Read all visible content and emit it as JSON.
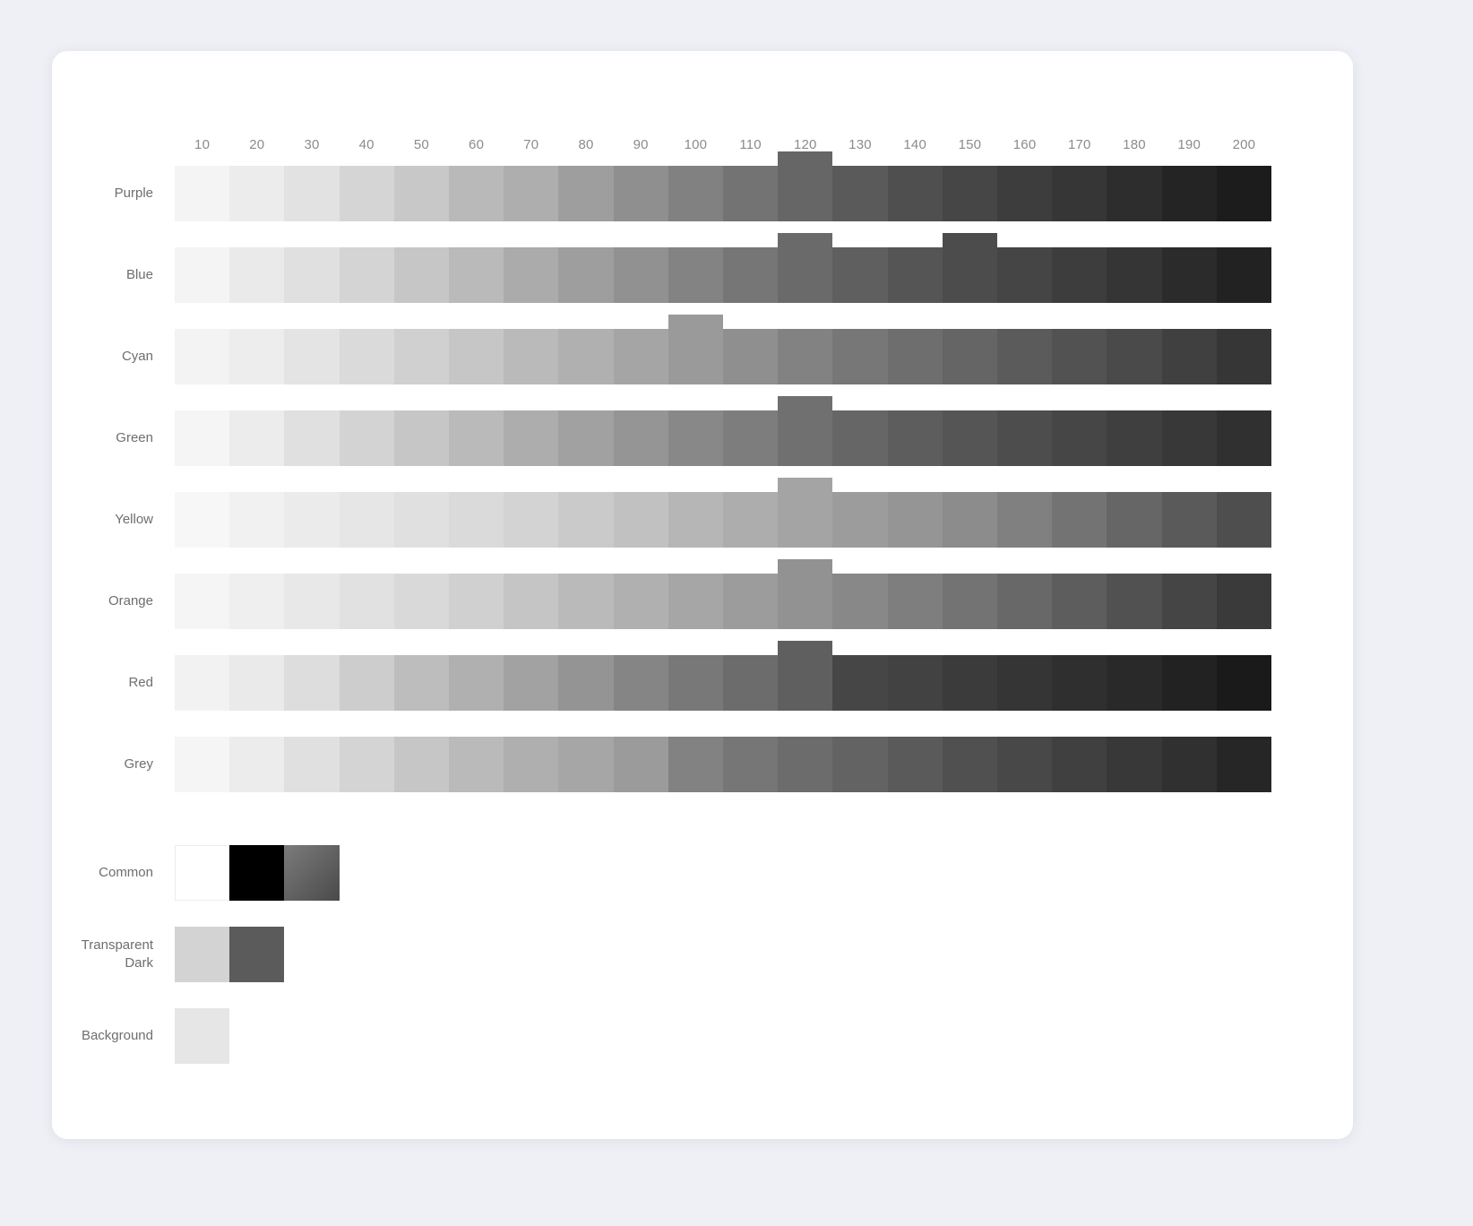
{
  "card": {
    "background": "#ffffff",
    "page_background": "#eef0f5"
  },
  "columns": {
    "labels": [
      "10",
      "20",
      "30",
      "40",
      "50",
      "60",
      "70",
      "80",
      "90",
      "100",
      "110",
      "120",
      "130",
      "140",
      "150",
      "160",
      "170",
      "180",
      "190",
      "200"
    ],
    "label_color": "#8b8b8b"
  },
  "rows": [
    {
      "label": "Purple",
      "highlighted": [
        "120"
      ],
      "swatches": [
        "#f4f4f4",
        "#ececec",
        "#e2e2e2",
        "#d5d5d5",
        "#c8c8c8",
        "#b9b9b9",
        "#aeaeae",
        "#9e9e9e",
        "#8f8f8f",
        "#818181",
        "#737373",
        "#666666",
        "#5a5a5a",
        "#4f4f4f",
        "#464646",
        "#3d3d3d",
        "#363636",
        "#2d2d2d",
        "#242424",
        "#1c1c1c"
      ]
    },
    {
      "label": "Blue",
      "highlighted": [
        "120",
        "150"
      ],
      "swatches": [
        "#f4f4f4",
        "#eaeaea",
        "#e0e0e0",
        "#d4d4d4",
        "#c6c6c6",
        "#bababa",
        "#ababab",
        "#9e9e9e",
        "#919191",
        "#838383",
        "#767676",
        "#6a6a6a",
        "#5f5f5f",
        "#555555",
        "#4c4c4c",
        "#454545",
        "#3d3d3d",
        "#353535",
        "#2b2b2b",
        "#222222"
      ]
    },
    {
      "label": "Cyan",
      "highlighted": [
        "100"
      ],
      "swatches": [
        "#f3f3f3",
        "#ededed",
        "#e4e4e4",
        "#dadada",
        "#d0d0d0",
        "#c6c6c6",
        "#bababa",
        "#b0b0b0",
        "#a5a5a5",
        "#9a9a9a",
        "#8f8f8f",
        "#828282",
        "#777777",
        "#6e6e6e",
        "#656565",
        "#5b5b5b",
        "#525252",
        "#4a4a4a",
        "#404040",
        "#363636"
      ]
    },
    {
      "label": "Green",
      "highlighted": [
        "120"
      ],
      "swatches": [
        "#f5f5f5",
        "#ececec",
        "#e0e0e0",
        "#d3d3d3",
        "#c6c6c6",
        "#bababa",
        "#adadad",
        "#a1a1a1",
        "#959595",
        "#888888",
        "#7d7d7d",
        "#707070",
        "#666666",
        "#5d5d5d",
        "#555555",
        "#4d4d4d",
        "#464646",
        "#3f3f3f",
        "#383838",
        "#303030"
      ]
    },
    {
      "label": "Yellow",
      "highlighted": [
        "120"
      ],
      "swatches": [
        "#f7f7f7",
        "#f1f1f1",
        "#ebebeb",
        "#e6e6e6",
        "#e0e0e0",
        "#dadada",
        "#d3d3d3",
        "#cacaca",
        "#c1c1c1",
        "#b6b6b6",
        "#adadad",
        "#a4a4a4",
        "#9c9c9c",
        "#959595",
        "#8c8c8c",
        "#808080",
        "#737373",
        "#666666",
        "#5a5a5a",
        "#4e4e4e"
      ]
    },
    {
      "label": "Orange",
      "highlighted": [
        "120"
      ],
      "swatches": [
        "#f5f5f5",
        "#efefef",
        "#e8e8e8",
        "#e1e1e1",
        "#d9d9d9",
        "#d0d0d0",
        "#c5c5c5",
        "#bababa",
        "#b0b0b0",
        "#a6a6a6",
        "#9c9c9c",
        "#929292",
        "#888888",
        "#7e7e7e",
        "#737373",
        "#686868",
        "#5d5d5d",
        "#515151",
        "#454545",
        "#3a3a3a"
      ]
    },
    {
      "label": "Red",
      "highlighted": [
        "120"
      ],
      "swatches": [
        "#f2f2f2",
        "#eaeaea",
        "#dddddd",
        "#cdcdcd",
        "#bdbdbd",
        "#b0b0b0",
        "#a2a2a2",
        "#949494",
        "#858585",
        "#787878",
        "#6c6c6c",
        "#5f5f5f",
        "#464646",
        "#424242",
        "#3b3b3b",
        "#353535",
        "#2f2f2f",
        "#292929",
        "#222222",
        "#1a1a1a"
      ]
    },
    {
      "label": "Grey",
      "highlighted": [],
      "swatches": [
        "#f5f5f5",
        "#ececec",
        "#e0e0e0",
        "#d4d4d4",
        "#c6c6c6",
        "#bababa",
        "#afafaf",
        "#a6a6a6",
        "#9b9b9b",
        "#828282",
        "#767676",
        "#6c6c6c",
        "#636363",
        "#5a5a5a",
        "#505050",
        "#484848",
        "#404040",
        "#383838",
        "#303030",
        "#262626"
      ]
    }
  ],
  "special_rows": [
    {
      "label": "Common",
      "swatches": [
        {
          "name": "white",
          "color": "#ffffff",
          "bordered": true
        },
        {
          "name": "black",
          "color": "#000000",
          "bordered": false
        },
        {
          "name": "gradient",
          "color": "#7b7b7b",
          "gradient_to": "#4a4a4a",
          "bordered": false
        }
      ]
    },
    {
      "label": "Transparent\nDark",
      "swatches": [
        {
          "name": "transparent-light",
          "color": "#d3d3d3",
          "bordered": false
        },
        {
          "name": "transparent-dark",
          "color": "#5b5b5b",
          "bordered": false
        }
      ]
    },
    {
      "label": "Background",
      "swatches": [
        {
          "name": "background",
          "color": "#e6e6e6",
          "bordered": false
        }
      ]
    }
  ],
  "chart_data": {
    "type": "heatmap",
    "title": "",
    "xlabel": "",
    "ylabel": "",
    "categories": [
      "10",
      "20",
      "30",
      "40",
      "50",
      "60",
      "70",
      "80",
      "90",
      "100",
      "110",
      "120",
      "130",
      "140",
      "150",
      "160",
      "170",
      "180",
      "190",
      "200"
    ],
    "series": [
      {
        "name": "Purple",
        "values": [
          "#f4f4f4",
          "#ececec",
          "#e2e2e2",
          "#d5d5d5",
          "#c8c8c8",
          "#b9b9b9",
          "#aeaeae",
          "#9e9e9e",
          "#8f8f8f",
          "#818181",
          "#737373",
          "#666666",
          "#5a5a5a",
          "#4f4f4f",
          "#464646",
          "#3d3d3d",
          "#363636",
          "#2d2d2d",
          "#242424",
          "#1c1c1c"
        ]
      },
      {
        "name": "Blue",
        "values": [
          "#f4f4f4",
          "#eaeaea",
          "#e0e0e0",
          "#d4d4d4",
          "#c6c6c6",
          "#bababa",
          "#ababab",
          "#9e9e9e",
          "#919191",
          "#838383",
          "#767676",
          "#6a6a6a",
          "#5f5f5f",
          "#555555",
          "#4c4c4c",
          "#454545",
          "#3d3d3d",
          "#353535",
          "#2b2b2b",
          "#222222"
        ]
      },
      {
        "name": "Cyan",
        "values": [
          "#f3f3f3",
          "#ededed",
          "#e4e4e4",
          "#dadada",
          "#d0d0d0",
          "#c6c6c6",
          "#bababa",
          "#b0b0b0",
          "#a5a5a5",
          "#9a9a9a",
          "#8f8f8f",
          "#828282",
          "#777777",
          "#6e6e6e",
          "#656565",
          "#5b5b5b",
          "#525252",
          "#4a4a4a",
          "#404040",
          "#363636"
        ]
      },
      {
        "name": "Green",
        "values": [
          "#f5f5f5",
          "#ececec",
          "#e0e0e0",
          "#d3d3d3",
          "#c6c6c6",
          "#bababa",
          "#adadad",
          "#a1a1a1",
          "#959595",
          "#888888",
          "#7d7d7d",
          "#707070",
          "#666666",
          "#5d5d5d",
          "#555555",
          "#4d4d4d",
          "#464646",
          "#3f3f3f",
          "#383838",
          "#303030"
        ]
      },
      {
        "name": "Yellow",
        "values": [
          "#f7f7f7",
          "#f1f1f1",
          "#ebebeb",
          "#e6e6e6",
          "#e0e0e0",
          "#dadada",
          "#d3d3d3",
          "#cacaca",
          "#c1c1c1",
          "#b6b6b6",
          "#adadad",
          "#a4a4a4",
          "#9c9c9c",
          "#959595",
          "#8c8c8c",
          "#808080",
          "#737373",
          "#666666",
          "#5a5a5a",
          "#4e4e4e"
        ]
      },
      {
        "name": "Orange",
        "values": [
          "#f5f5f5",
          "#efefef",
          "#e8e8e8",
          "#e1e1e1",
          "#d9d9d9",
          "#d0d0d0",
          "#c5c5c5",
          "#bababa",
          "#b0b0b0",
          "#a6a6a6",
          "#9c9c9c",
          "#929292",
          "#888888",
          "#7e7e7e",
          "#737373",
          "#686868",
          "#5d5d5d",
          "#515151",
          "#454545",
          "#3a3a3a"
        ]
      },
      {
        "name": "Red",
        "values": [
          "#f2f2f2",
          "#eaeaea",
          "#dddddd",
          "#cdcdcd",
          "#bdbdbd",
          "#b0b0b0",
          "#a2a2a2",
          "#949494",
          "#858585",
          "#787878",
          "#6c6c6c",
          "#5f5f5f",
          "#464646",
          "#424242",
          "#3b3b3b",
          "#353535",
          "#2f2f2f",
          "#292929",
          "#222222",
          "#1a1a1a"
        ]
      },
      {
        "name": "Grey",
        "values": [
          "#f5f5f5",
          "#ececec",
          "#e0e0e0",
          "#d4d4d4",
          "#c6c6c6",
          "#bababa",
          "#afafaf",
          "#a6a6a6",
          "#9b9b9b",
          "#828282",
          "#767676",
          "#6c6c6c",
          "#636363",
          "#5a5a5a",
          "#505050",
          "#484848",
          "#404040",
          "#383838",
          "#303030",
          "#262626"
        ]
      }
    ],
    "legend_position": "none",
    "grid": false
  }
}
